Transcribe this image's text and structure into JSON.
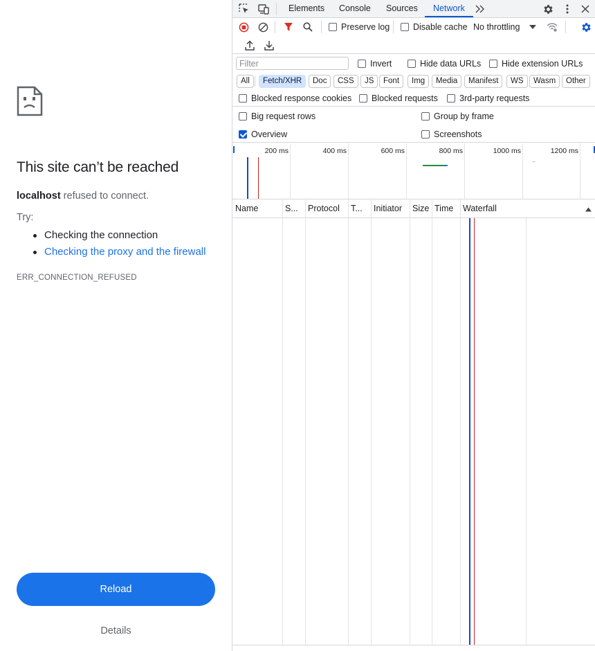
{
  "error_page": {
    "title": "This site can’t be reached",
    "host": "localhost",
    "message": " refused to connect.",
    "try_label": "Try:",
    "suggestions": [
      {
        "label": "Checking the connection",
        "is_link": false
      },
      {
        "label": "Checking the proxy and the firewall",
        "is_link": true
      }
    ],
    "error_code": "ERR_CONNECTION_REFUSED",
    "reload_label": "Reload",
    "details_label": "Details",
    "accent_color": "#1a73e8"
  },
  "devtools": {
    "tabs": [
      "Elements",
      "Console",
      "Sources",
      "Network"
    ],
    "active_tab": "Network",
    "toolbar": {
      "preserve_log": "Preserve log",
      "disable_cache": "Disable cache",
      "throttling": "No throttling",
      "recording": true
    },
    "filter": {
      "placeholder": "Filter",
      "invert": "Invert",
      "hide_data_urls": "Hide data URLs",
      "hide_extension_urls": "Hide extension URLs"
    },
    "type_filters": [
      "All",
      "Fetch/XHR",
      "Doc",
      "CSS",
      "JS",
      "Font",
      "Img",
      "Media",
      "Manifest",
      "WS",
      "Wasm",
      "Other"
    ],
    "active_type_filter": "Fetch/XHR",
    "blocked": {
      "blocked_response_cookies": "Blocked response cookies",
      "blocked_requests": "Blocked requests",
      "third_party_requests": "3rd-party requests"
    },
    "options": {
      "big_request_rows": "Big request rows",
      "group_by_frame": "Group by frame",
      "overview": "Overview",
      "overview_checked": true,
      "screenshots": "Screenshots"
    },
    "overview_ticks": [
      "200 ms",
      "400 ms",
      "600 ms",
      "800 ms",
      "1000 ms",
      "1200 ms"
    ],
    "columns": [
      "Name",
      "S...",
      "Protocol",
      "T...",
      "Initiator",
      "Size",
      "Time",
      "Waterfall"
    ],
    "colors": {
      "accent": "#0b57d0",
      "record": "#d93025",
      "dom_content_loaded": "#1a3fdb",
      "load": "#c5221f"
    }
  }
}
